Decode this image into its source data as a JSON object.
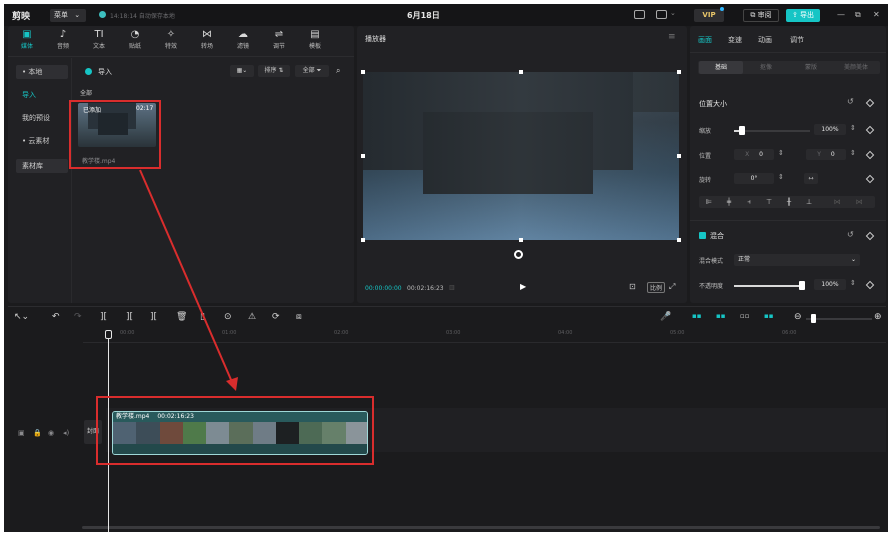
{
  "titlebar": {
    "logo": "剪映",
    "menu_label": "菜单",
    "save_status": "14:18:14 自动保存本地",
    "project_title": "6月18日",
    "vip_label": "VIP",
    "review_label": "审阅",
    "export_label": "导出"
  },
  "media_tabs": [
    {
      "icon": "▣",
      "label": "媒体"
    },
    {
      "icon": "♪",
      "label": "音频"
    },
    {
      "icon": "TI",
      "label": "文本"
    },
    {
      "icon": "◔",
      "label": "贴纸"
    },
    {
      "icon": "✧",
      "label": "特效"
    },
    {
      "icon": "⋈",
      "label": "转场"
    },
    {
      "icon": "☁",
      "label": "滤镜"
    },
    {
      "icon": "⇌",
      "label": "调节"
    },
    {
      "icon": "▤",
      "label": "模板"
    }
  ],
  "media_sidebar": {
    "local": "• 本地",
    "import": "导入",
    "my_presets": "我的预设",
    "cloud": "• 云素材",
    "library": "素材库"
  },
  "media_toolbar": {
    "import": "导入",
    "sort": "排序",
    "filter": "全部"
  },
  "media": {
    "all_label": "全部",
    "clip_added": "已添加",
    "clip_duration": "02:17",
    "clip_name": "教学楼.mp4"
  },
  "player": {
    "title": "播放器",
    "current_time": "00:00:00:00",
    "total_time": "00:02:16:23",
    "ratio_label": "比例"
  },
  "props": {
    "tabs": [
      "画面",
      "变速",
      "动画",
      "调节"
    ],
    "sub_tabs": [
      "基础",
      "抠像",
      "蒙版",
      "美颜美体"
    ],
    "position_size": "位置大小",
    "scale_label": "缩放",
    "scale_value": "100%",
    "position_label": "位置",
    "pos_x_label": "X",
    "pos_x": "0",
    "pos_y_label": "Y",
    "pos_y": "0",
    "rotate_label": "旋转",
    "rotate_value": "0°",
    "blend_title": "混合",
    "blend_mode_label": "混合模式",
    "blend_mode_value": "正常",
    "opacity_label": "不透明度",
    "opacity_value": "100%",
    "scale_level": 0.1,
    "opacity_level": 1.0
  },
  "timeline": {
    "ticks": [
      "00:00",
      "01:00",
      "02:00",
      "03:00",
      "04:00",
      "05:00",
      "06:00"
    ],
    "cover_label": "封面",
    "clip_name": "教学楼.mp4",
    "clip_duration": "00:02:16:23"
  },
  "colors": {
    "accent": "#16c5c5",
    "annotation": "#d92d2d"
  }
}
